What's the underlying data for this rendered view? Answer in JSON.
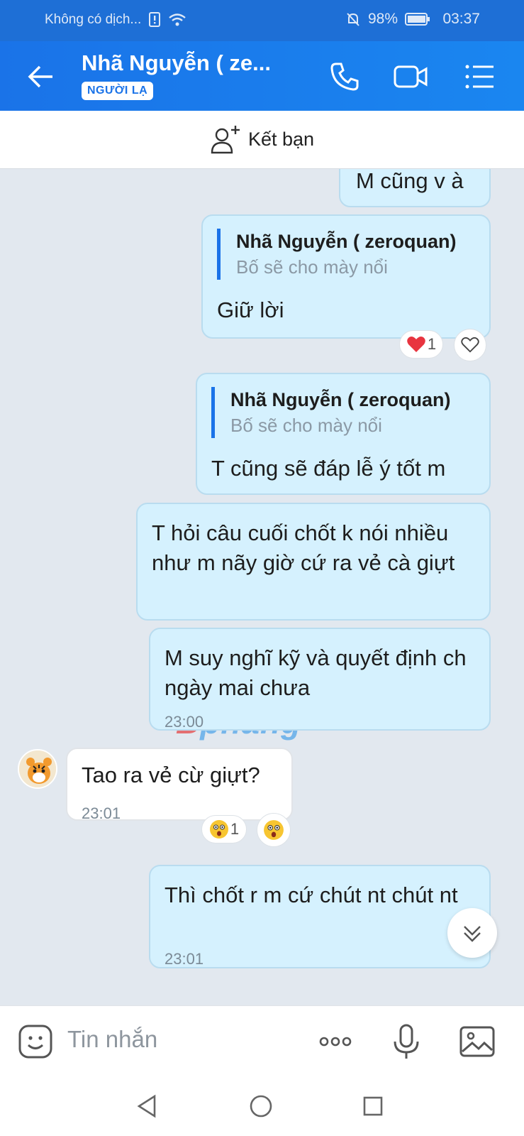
{
  "status_bar": {
    "carrier": "Không có dịch...",
    "battery": "98%",
    "time": "03:37",
    "icons": [
      "sim-alert-icon",
      "wifi-icon",
      "mute-bell-icon",
      "battery-icon"
    ]
  },
  "header": {
    "title": "Nhã Nguyễn ( ze...",
    "badge": "NGƯỜI LẠ",
    "icons": [
      "back-arrow-icon",
      "phone-icon",
      "video-icon",
      "menu-icon"
    ]
  },
  "add_friend": {
    "label": "Kết bạn",
    "icon": "add-user-icon"
  },
  "messages": [
    {
      "side": "out",
      "text": "M cũng v à"
    },
    {
      "side": "out",
      "quote_name": "Nhã Nguyễn ( zeroquan)",
      "quote_text": "Bố sẽ cho mày nổi",
      "text": "Giữ lời",
      "reaction_count": "1"
    },
    {
      "side": "out",
      "quote_name": "Nhã Nguyễn ( zeroquan)",
      "quote_text": "Bố sẽ cho mày nổi",
      "text": "T cũng sẽ đáp lễ ý tốt m"
    },
    {
      "side": "out",
      "text": "T hỏi câu cuối chốt k nói nhiều như m nãy giờ cứ ra vẻ cà giựt"
    },
    {
      "side": "out",
      "text": "M suy nghĩ kỹ và quyết định ch ngày mai chưa",
      "time": "23:00"
    },
    {
      "side": "in",
      "text": "Tao ra vẻ cừ giựt?",
      "time": "23:01",
      "reaction_count": "1"
    },
    {
      "side": "out",
      "text": "Thì chốt r m cứ chút nt chút nt",
      "time": "23:01"
    }
  ],
  "watermark": {
    "first": "B",
    "rest": "phang"
  },
  "input_bar": {
    "placeholder": "Tin nhắn",
    "icons": [
      "sticker-icon",
      "more-icon",
      "microphone-icon",
      "image-icon"
    ]
  },
  "nav_bar": {
    "icons": [
      "back-nav-icon",
      "home-nav-icon",
      "recents-nav-icon"
    ]
  },
  "colors": {
    "accent": "#1a73e8",
    "bubble_out": "#d5f1fe",
    "bubble_in": "#ffffff",
    "chat_bg": "#e2e8ef"
  }
}
